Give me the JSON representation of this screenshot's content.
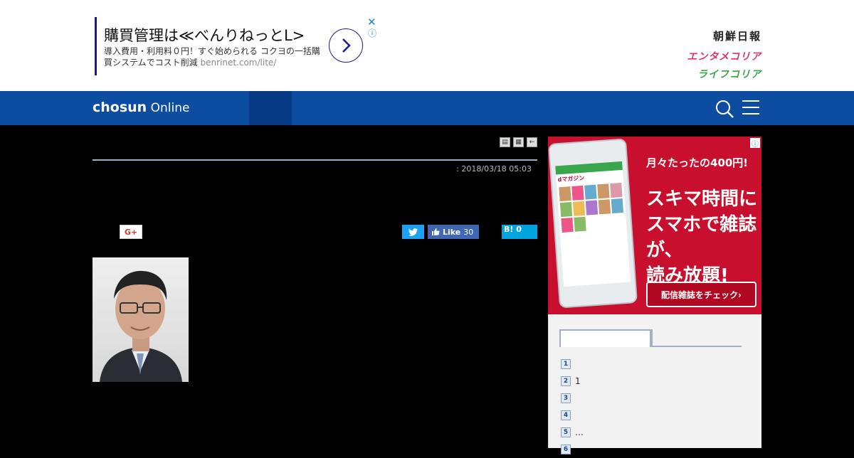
{
  "ad": {
    "title": "購買管理は≪べんりねっとL>",
    "desc": "導入費用・利用料０円！すぐ始められる コクヨの一括購買システムでコスト削減",
    "url": "benrinet.com/lite/",
    "close": "✕",
    "info": "ⓘ"
  },
  "brands": {
    "chosun": "朝鮮日報",
    "entame": "エンタメコリア",
    "life": "ライフコリア"
  },
  "nav": {
    "logo_bold": "chosun",
    "logo_light": "Online"
  },
  "article": {
    "date": ": 2018/03/18 05:03",
    "tools": [
      "▤",
      "▦",
      "←"
    ]
  },
  "share": {
    "gplus": "G+",
    "fb_like": "Like",
    "fb_count": "30",
    "hatena": "B!",
    "hatena_count": "0"
  },
  "side_ad": {
    "line1": "月々たったの400円!",
    "line2": "スキマ時間に",
    "line3": "スマホで雑誌が、",
    "line4": "読み放題!",
    "cta": "配信雑誌をチェック›",
    "app_name": "dマガジン",
    "info": "ⓘ"
  },
  "ranking": {
    "items": [
      {
        "num": "1",
        "text": ""
      },
      {
        "num": "2",
        "text": "1"
      },
      {
        "num": "3",
        "text": ""
      },
      {
        "num": "4",
        "text": ""
      },
      {
        "num": "5",
        "text": "…"
      },
      {
        "num": "6",
        "text": ""
      }
    ]
  },
  "colors": {
    "nav": "#0c4da2",
    "ad_red": "#c8102e",
    "twitter": "#1da1f2",
    "facebook": "#4267b2",
    "hatena": "#00a4de"
  }
}
